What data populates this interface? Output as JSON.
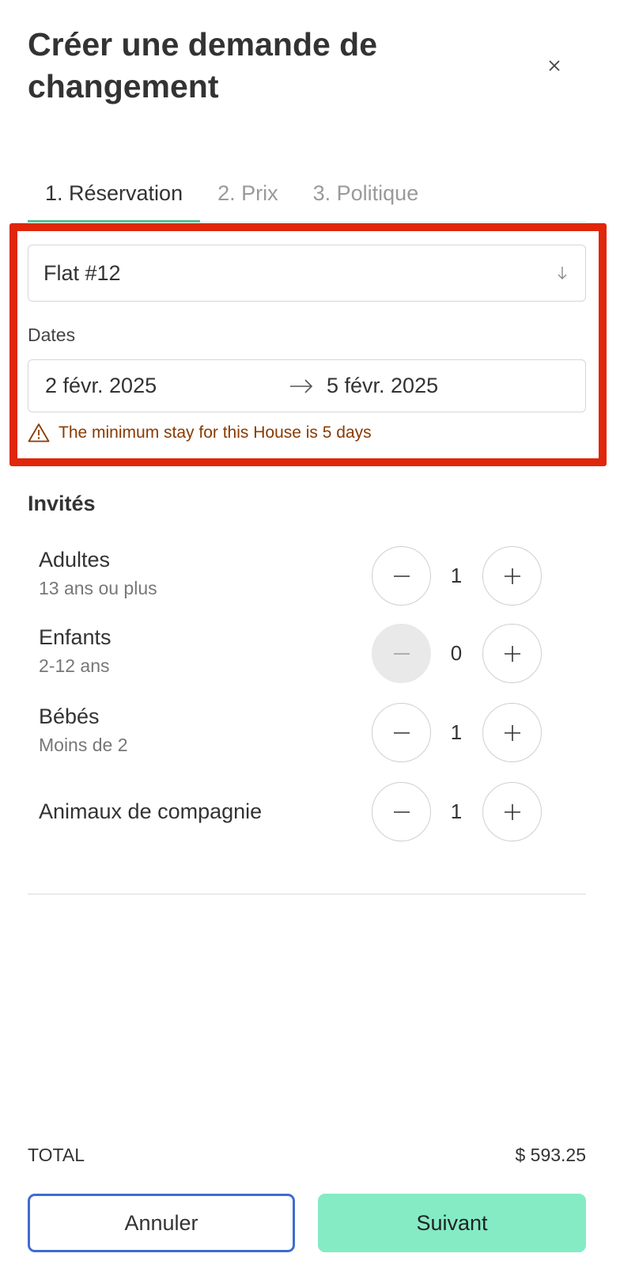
{
  "header": {
    "title": "Créer une demande de changement",
    "close_icon": "close-icon"
  },
  "tabs": [
    {
      "label": "1. Réservation",
      "active": true
    },
    {
      "label": "2. Prix",
      "active": false
    },
    {
      "label": "3. Politique",
      "active": false
    }
  ],
  "booking": {
    "property_select": {
      "value": "Flat #12",
      "icon": "arrow-down-icon"
    },
    "dates_label": "Dates",
    "start_date": "2 févr. 2025",
    "end_date": "5 févr. 2025",
    "range_icon": "arrow-right-icon",
    "warning": {
      "icon": "warning-icon",
      "text": "The minimum stay for this House is 5 days",
      "color": "#8a3a00"
    }
  },
  "guests": {
    "title": "Invités",
    "rows": [
      {
        "name": "Adultes",
        "desc": "13 ans ou plus",
        "value": "1",
        "minus_disabled": false
      },
      {
        "name": "Enfants",
        "desc": "2-12 ans",
        "value": "0",
        "minus_disabled": true
      },
      {
        "name": "Bébés",
        "desc": "Moins de 2",
        "value": "1",
        "minus_disabled": false
      },
      {
        "name": "Animaux de compagnie",
        "desc": "",
        "value": "1",
        "minus_disabled": false
      }
    ]
  },
  "footer": {
    "total_label": "TOTAL",
    "total_value": "$ 593.25",
    "cancel_label": "Annuler",
    "next_label": "Suivant"
  },
  "colors": {
    "accent_green": "#5cbf8f",
    "next_button": "#84ebc5",
    "cancel_border": "#3d6dd1",
    "highlight_box": "#e0260b"
  }
}
